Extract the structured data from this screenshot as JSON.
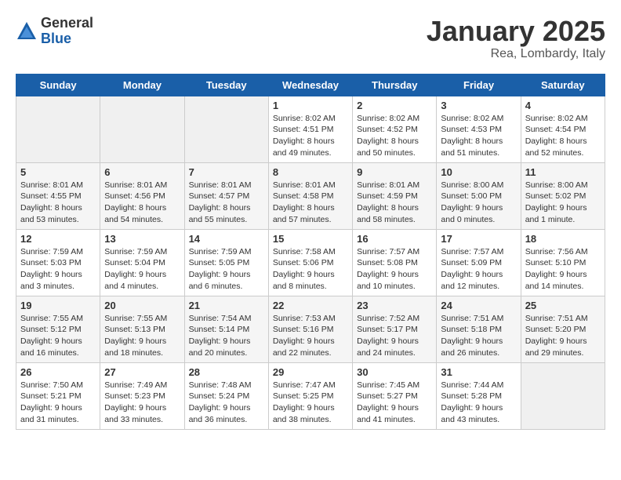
{
  "logo": {
    "general": "General",
    "blue": "Blue"
  },
  "title": {
    "month": "January 2025",
    "location": "Rea, Lombardy, Italy"
  },
  "weekdays": [
    "Sunday",
    "Monday",
    "Tuesday",
    "Wednesday",
    "Thursday",
    "Friday",
    "Saturday"
  ],
  "weeks": [
    [
      {
        "day": "",
        "sunrise": "",
        "sunset": "",
        "daylight": ""
      },
      {
        "day": "",
        "sunrise": "",
        "sunset": "",
        "daylight": ""
      },
      {
        "day": "",
        "sunrise": "",
        "sunset": "",
        "daylight": ""
      },
      {
        "day": "1",
        "sunrise": "Sunrise: 8:02 AM",
        "sunset": "Sunset: 4:51 PM",
        "daylight": "Daylight: 8 hours and 49 minutes."
      },
      {
        "day": "2",
        "sunrise": "Sunrise: 8:02 AM",
        "sunset": "Sunset: 4:52 PM",
        "daylight": "Daylight: 8 hours and 50 minutes."
      },
      {
        "day": "3",
        "sunrise": "Sunrise: 8:02 AM",
        "sunset": "Sunset: 4:53 PM",
        "daylight": "Daylight: 8 hours and 51 minutes."
      },
      {
        "day": "4",
        "sunrise": "Sunrise: 8:02 AM",
        "sunset": "Sunset: 4:54 PM",
        "daylight": "Daylight: 8 hours and 52 minutes."
      }
    ],
    [
      {
        "day": "5",
        "sunrise": "Sunrise: 8:01 AM",
        "sunset": "Sunset: 4:55 PM",
        "daylight": "Daylight: 8 hours and 53 minutes."
      },
      {
        "day": "6",
        "sunrise": "Sunrise: 8:01 AM",
        "sunset": "Sunset: 4:56 PM",
        "daylight": "Daylight: 8 hours and 54 minutes."
      },
      {
        "day": "7",
        "sunrise": "Sunrise: 8:01 AM",
        "sunset": "Sunset: 4:57 PM",
        "daylight": "Daylight: 8 hours and 55 minutes."
      },
      {
        "day": "8",
        "sunrise": "Sunrise: 8:01 AM",
        "sunset": "Sunset: 4:58 PM",
        "daylight": "Daylight: 8 hours and 57 minutes."
      },
      {
        "day": "9",
        "sunrise": "Sunrise: 8:01 AM",
        "sunset": "Sunset: 4:59 PM",
        "daylight": "Daylight: 8 hours and 58 minutes."
      },
      {
        "day": "10",
        "sunrise": "Sunrise: 8:00 AM",
        "sunset": "Sunset: 5:00 PM",
        "daylight": "Daylight: 9 hours and 0 minutes."
      },
      {
        "day": "11",
        "sunrise": "Sunrise: 8:00 AM",
        "sunset": "Sunset: 5:02 PM",
        "daylight": "Daylight: 9 hours and 1 minute."
      }
    ],
    [
      {
        "day": "12",
        "sunrise": "Sunrise: 7:59 AM",
        "sunset": "Sunset: 5:03 PM",
        "daylight": "Daylight: 9 hours and 3 minutes."
      },
      {
        "day": "13",
        "sunrise": "Sunrise: 7:59 AM",
        "sunset": "Sunset: 5:04 PM",
        "daylight": "Daylight: 9 hours and 4 minutes."
      },
      {
        "day": "14",
        "sunrise": "Sunrise: 7:59 AM",
        "sunset": "Sunset: 5:05 PM",
        "daylight": "Daylight: 9 hours and 6 minutes."
      },
      {
        "day": "15",
        "sunrise": "Sunrise: 7:58 AM",
        "sunset": "Sunset: 5:06 PM",
        "daylight": "Daylight: 9 hours and 8 minutes."
      },
      {
        "day": "16",
        "sunrise": "Sunrise: 7:57 AM",
        "sunset": "Sunset: 5:08 PM",
        "daylight": "Daylight: 9 hours and 10 minutes."
      },
      {
        "day": "17",
        "sunrise": "Sunrise: 7:57 AM",
        "sunset": "Sunset: 5:09 PM",
        "daylight": "Daylight: 9 hours and 12 minutes."
      },
      {
        "day": "18",
        "sunrise": "Sunrise: 7:56 AM",
        "sunset": "Sunset: 5:10 PM",
        "daylight": "Daylight: 9 hours and 14 minutes."
      }
    ],
    [
      {
        "day": "19",
        "sunrise": "Sunrise: 7:55 AM",
        "sunset": "Sunset: 5:12 PM",
        "daylight": "Daylight: 9 hours and 16 minutes."
      },
      {
        "day": "20",
        "sunrise": "Sunrise: 7:55 AM",
        "sunset": "Sunset: 5:13 PM",
        "daylight": "Daylight: 9 hours and 18 minutes."
      },
      {
        "day": "21",
        "sunrise": "Sunrise: 7:54 AM",
        "sunset": "Sunset: 5:14 PM",
        "daylight": "Daylight: 9 hours and 20 minutes."
      },
      {
        "day": "22",
        "sunrise": "Sunrise: 7:53 AM",
        "sunset": "Sunset: 5:16 PM",
        "daylight": "Daylight: 9 hours and 22 minutes."
      },
      {
        "day": "23",
        "sunrise": "Sunrise: 7:52 AM",
        "sunset": "Sunset: 5:17 PM",
        "daylight": "Daylight: 9 hours and 24 minutes."
      },
      {
        "day": "24",
        "sunrise": "Sunrise: 7:51 AM",
        "sunset": "Sunset: 5:18 PM",
        "daylight": "Daylight: 9 hours and 26 minutes."
      },
      {
        "day": "25",
        "sunrise": "Sunrise: 7:51 AM",
        "sunset": "Sunset: 5:20 PM",
        "daylight": "Daylight: 9 hours and 29 minutes."
      }
    ],
    [
      {
        "day": "26",
        "sunrise": "Sunrise: 7:50 AM",
        "sunset": "Sunset: 5:21 PM",
        "daylight": "Daylight: 9 hours and 31 minutes."
      },
      {
        "day": "27",
        "sunrise": "Sunrise: 7:49 AM",
        "sunset": "Sunset: 5:23 PM",
        "daylight": "Daylight: 9 hours and 33 minutes."
      },
      {
        "day": "28",
        "sunrise": "Sunrise: 7:48 AM",
        "sunset": "Sunset: 5:24 PM",
        "daylight": "Daylight: 9 hours and 36 minutes."
      },
      {
        "day": "29",
        "sunrise": "Sunrise: 7:47 AM",
        "sunset": "Sunset: 5:25 PM",
        "daylight": "Daylight: 9 hours and 38 minutes."
      },
      {
        "day": "30",
        "sunrise": "Sunrise: 7:45 AM",
        "sunset": "Sunset: 5:27 PM",
        "daylight": "Daylight: 9 hours and 41 minutes."
      },
      {
        "day": "31",
        "sunrise": "Sunrise: 7:44 AM",
        "sunset": "Sunset: 5:28 PM",
        "daylight": "Daylight: 9 hours and 43 minutes."
      },
      {
        "day": "",
        "sunrise": "",
        "sunset": "",
        "daylight": ""
      }
    ]
  ]
}
